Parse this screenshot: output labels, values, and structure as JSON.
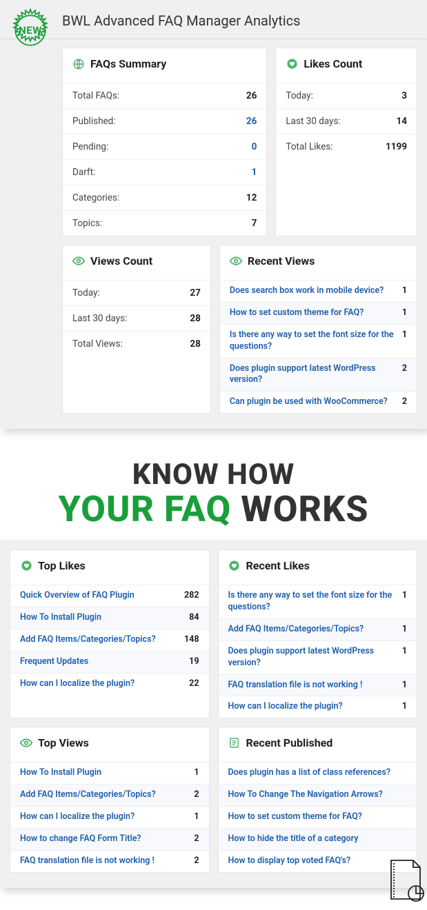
{
  "badge": "NEW",
  "title": "BWL Advanced FAQ Manager Analytics",
  "summary": {
    "title": "FAQs Summary",
    "rows": [
      {
        "label": "Total FAQs:",
        "value": "26",
        "link": false
      },
      {
        "label": "Published:",
        "value": "26",
        "link": true
      },
      {
        "label": "Pending:",
        "value": "0",
        "link": true
      },
      {
        "label": "Darft:",
        "value": "1",
        "link": true
      },
      {
        "label": "Categories:",
        "value": "12",
        "link": false
      },
      {
        "label": "Topics:",
        "value": "7",
        "link": false
      }
    ]
  },
  "likes": {
    "title": "Likes Count",
    "rows": [
      {
        "label": "Today:",
        "value": "3"
      },
      {
        "label": "Last 30 days:",
        "value": "14"
      },
      {
        "label": "Total Likes:",
        "value": "1199"
      }
    ]
  },
  "views": {
    "title": "Views Count",
    "rows": [
      {
        "label": "Today:",
        "value": "27"
      },
      {
        "label": "Last 30 days:",
        "value": "28"
      },
      {
        "label": "Total Views:",
        "value": "28"
      }
    ]
  },
  "recentViews": {
    "title": "Recent Views",
    "items": [
      {
        "text": "Does search box work in mobile device?",
        "n": "1"
      },
      {
        "text": "How to set custom theme for FAQ?",
        "n": "1"
      },
      {
        "text": "Is there any way to set the font size for the questions?",
        "n": "1"
      },
      {
        "text": "Does plugin support latest WordPress version?",
        "n": "2"
      },
      {
        "text": "Can plugin be used with WooCommerce?",
        "n": "2"
      }
    ]
  },
  "hero": {
    "line1": "KNOW HOW",
    "green": "YOUR FAQ",
    "rest": " WORKS"
  },
  "topLikes": {
    "title": "Top Likes",
    "items": [
      {
        "text": "Quick Overview of FAQ Plugin",
        "n": "282"
      },
      {
        "text": "How To Install Plugin",
        "n": "84"
      },
      {
        "text": "Add FAQ Items/Categories/Topics?",
        "n": "148"
      },
      {
        "text": "Frequent Updates",
        "n": "19"
      },
      {
        "text": "How can I localize the plugin?",
        "n": "22"
      }
    ]
  },
  "recentLikes": {
    "title": "Recent Likes",
    "items": [
      {
        "text": "Is there any way to set the font size for the questions?",
        "n": "1"
      },
      {
        "text": "Add FAQ Items/Categories/Topics?",
        "n": "1"
      },
      {
        "text": "Does plugin support latest WordPress version?",
        "n": "1"
      },
      {
        "text": "FAQ translation file is not working !",
        "n": "1"
      },
      {
        "text": "How can I localize the plugin?",
        "n": "1"
      }
    ]
  },
  "topViews": {
    "title": "Top Views",
    "items": [
      {
        "text": "How To Install Plugin",
        "n": "1"
      },
      {
        "text": "Add FAQ Items/Categories/Topics?",
        "n": "2"
      },
      {
        "text": "How can I localize the plugin?",
        "n": "1"
      },
      {
        "text": "How to change FAQ Form Title?",
        "n": "2"
      },
      {
        "text": "FAQ translation file is not working !",
        "n": "2"
      }
    ]
  },
  "recentPublished": {
    "title": "Recent Published",
    "items": [
      {
        "text": "Does plugin has a list of class references?"
      },
      {
        "text": "How To Change The Navigation Arrows?"
      },
      {
        "text": "How to set custom theme for FAQ?"
      },
      {
        "text": "How to hide the title of a category"
      },
      {
        "text": "How to display top voted FAQ's?"
      }
    ]
  }
}
